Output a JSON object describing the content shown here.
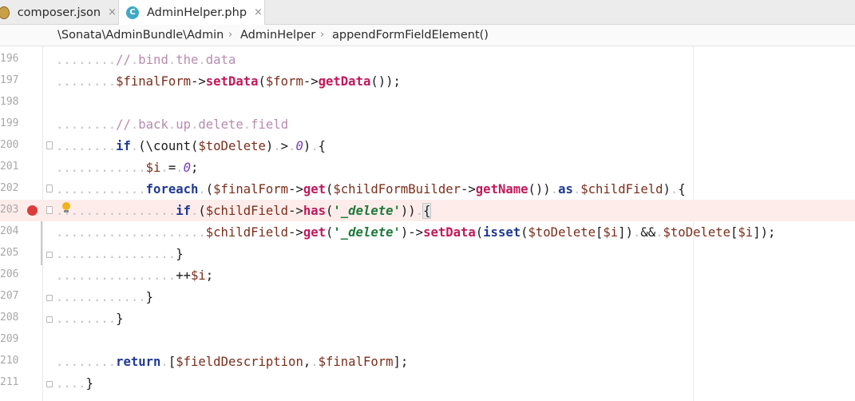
{
  "tabs": [
    {
      "label": "composer.json",
      "icon": "composer-json-icon",
      "active": false
    },
    {
      "label": "AdminHelper.php",
      "icon": "php-class-icon",
      "active": true
    }
  ],
  "tab_close_glyph": "×",
  "breadcrumb": [
    "\\Sonata\\AdminBundle\\Admin",
    "AdminHelper",
    "appendFormFieldElement()"
  ],
  "breadcrumb_separator": "›",
  "lines": [
    {
      "num": "196",
      "text": "........// bind the data"
    },
    {
      "num": "197",
      "text": "........$finalForm->setData($form->getData());"
    },
    {
      "num": "198",
      "text": ""
    },
    {
      "num": "199",
      "text": "........// back up delete field"
    },
    {
      "num": "200",
      "text": "........if (\\count($toDelete) > 0) {"
    },
    {
      "num": "201",
      "text": "............$i = 0;"
    },
    {
      "num": "202",
      "text": "............foreach ($finalForm->get($childFormBuilder->getName()) as $childField) {"
    },
    {
      "num": "203",
      "text": "................if ($childField->has('_delete')) {"
    },
    {
      "num": "204",
      "text": "....................$childField->get('_delete')->setData(isset($toDelete[$i]) && $toDelete[$i]);"
    },
    {
      "num": "205",
      "text": "................}"
    },
    {
      "num": "206",
      "text": "................++$i;"
    },
    {
      "num": "207",
      "text": "............}"
    },
    {
      "num": "208",
      "text": "........}"
    },
    {
      "num": "209",
      "text": ""
    },
    {
      "num": "210",
      "text": "........return [$fieldDescription, $finalForm];"
    },
    {
      "num": "211",
      "text": "....}"
    }
  ],
  "current_line": "203",
  "breakpoint_line": "203",
  "colors": {
    "breakpoint": "#dc3c3c",
    "current_line": "#fdecea",
    "keyword": "#1f3a93",
    "function": "#c2185b",
    "comment": "#b78bb0",
    "string": "#1f7a3a"
  }
}
